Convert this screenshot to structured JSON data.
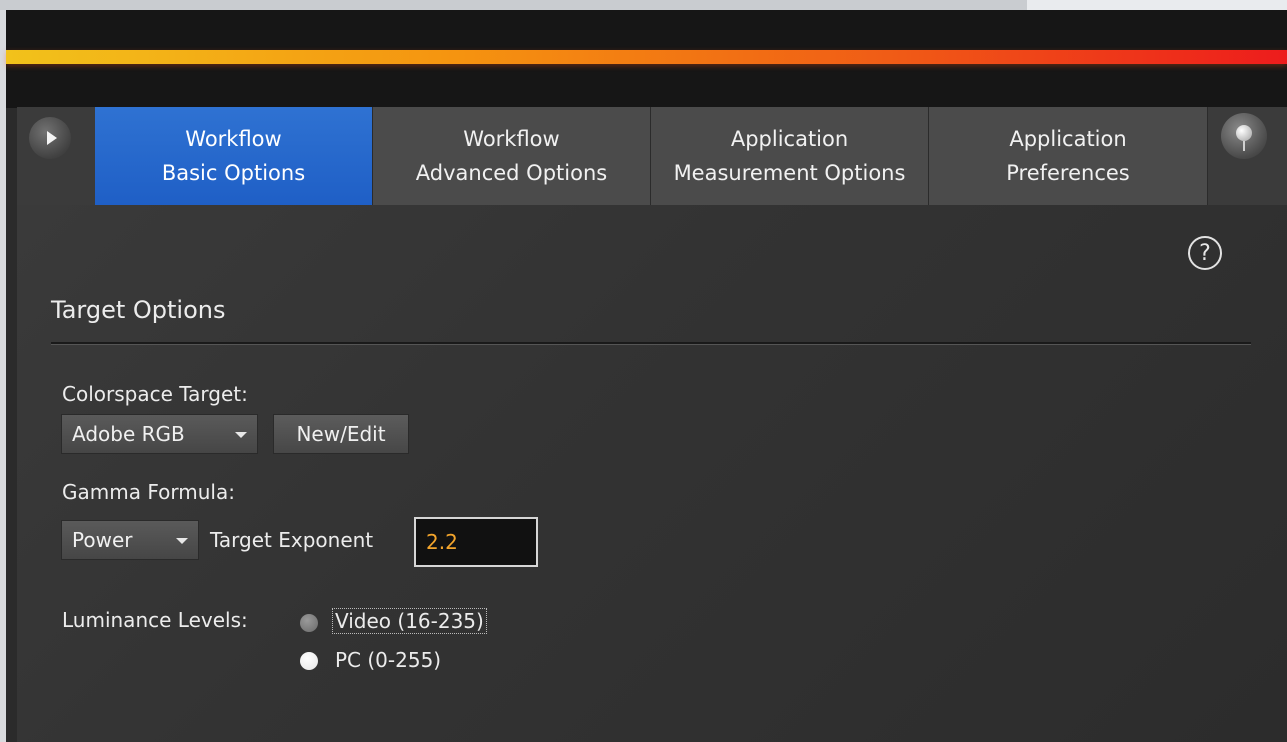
{
  "tabs": [
    {
      "line1": "Workflow",
      "line2": "Basic Options",
      "active": true
    },
    {
      "line1": "Workflow",
      "line2": "Advanced Options",
      "active": false
    },
    {
      "line1": "Application",
      "line2": "Measurement Options",
      "active": false
    },
    {
      "line1": "Application",
      "line2": "Preferences",
      "active": false
    }
  ],
  "help": {
    "glyph": "?"
  },
  "section": {
    "title": "Target Options"
  },
  "colorspace": {
    "label": "Colorspace Target:",
    "selected": "Adobe RGB",
    "new_edit_label": "New/Edit"
  },
  "gamma": {
    "label": "Gamma Formula:",
    "selected": "Power",
    "exponent_label": "Target Exponent",
    "exponent_value": "2.2"
  },
  "luminance": {
    "label": "Luminance Levels:",
    "options": [
      {
        "label": "Video (16-235)",
        "selected": false
      },
      {
        "label": "PC (0-255)",
        "selected": true
      }
    ]
  },
  "colors": {
    "active_tab": "#1f5fc6",
    "stripe_start": "#f2c21b",
    "stripe_end": "#ed1c1c",
    "exponent_text": "#f3a52c"
  }
}
